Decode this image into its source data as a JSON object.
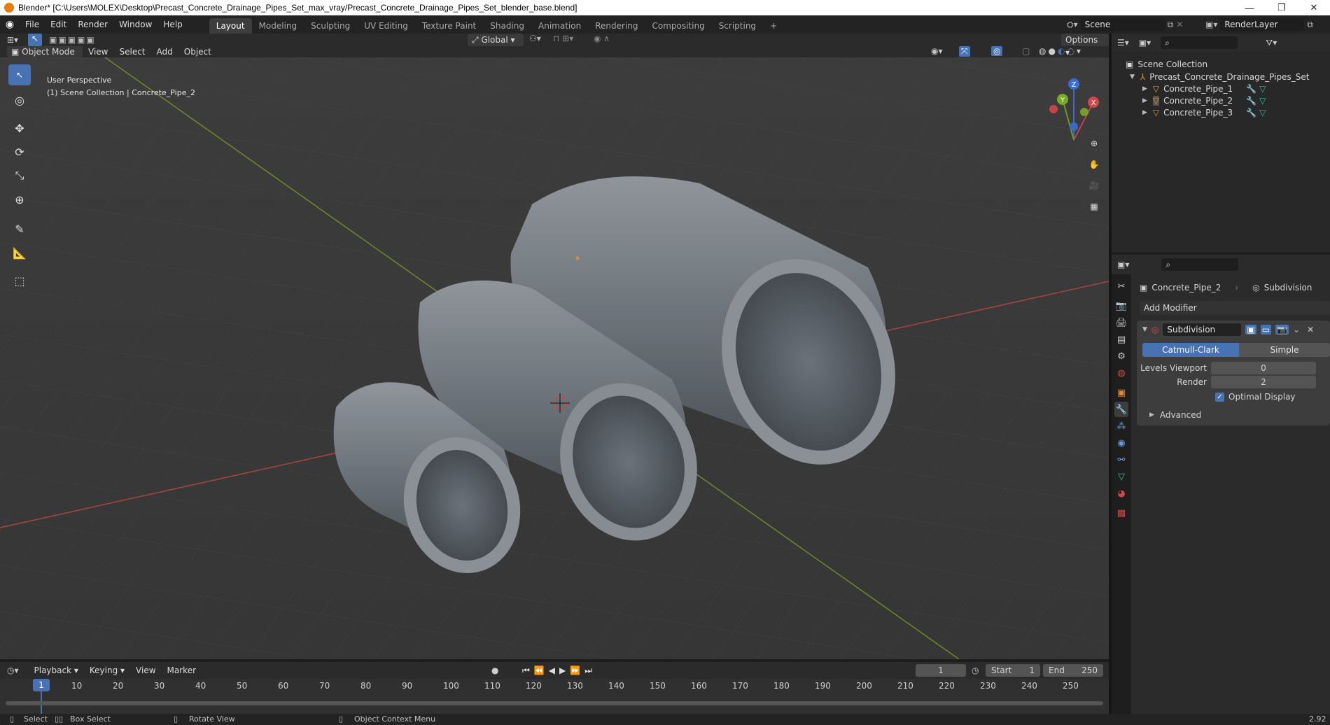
{
  "window": {
    "title": "Blender* [C:\\Users\\MOLEX\\Desktop\\Precast_Concrete_Drainage_Pipes_Set_max_vray/Precast_Concrete_Drainage_Pipes_Set_blender_base.blend]",
    "minimize": "—",
    "maximize": "❐",
    "close": "✕"
  },
  "menu": [
    "File",
    "Edit",
    "Render",
    "Window",
    "Help"
  ],
  "workspaces": [
    "Layout",
    "Modeling",
    "Sculpting",
    "UV Editing",
    "Texture Paint",
    "Shading",
    "Animation",
    "Rendering",
    "Compositing",
    "Scripting",
    "+"
  ],
  "scene": {
    "name": "Scene",
    "render_layer": "RenderLayer"
  },
  "viewport_header": {
    "orientation": "Global",
    "options": "Options",
    "mode": "Object Mode",
    "view": "View",
    "select": "Select",
    "add": "Add",
    "object": "Object"
  },
  "viewport": {
    "perspective": "User Perspective",
    "collection_info": "(1) Scene Collection | Concrete_Pipe_2"
  },
  "gizmo": {
    "z": "Z",
    "y": "Y",
    "x": "X"
  },
  "outliner": {
    "root": "Scene Collection",
    "collection": "Precast_Concrete_Drainage_Pipes_Set",
    "items": [
      "Concrete_Pipe_1",
      "Concrete_Pipe_2",
      "Concrete_Pipe_3"
    ]
  },
  "properties": {
    "object_name": "Concrete_Pipe_2",
    "modifier_label": "Subdivision",
    "add_modifier": "Add Modifier",
    "modifier": {
      "name": "Subdivision",
      "mode_a": "Catmull-Clark",
      "mode_b": "Simple",
      "levels_viewport_label": "Levels Viewport",
      "levels_viewport": "0",
      "render_label": "Render",
      "render": "2",
      "optimal_display": "Optimal Display",
      "optimal_display_checked": true,
      "advanced": "Advanced"
    }
  },
  "timeline": {
    "playback": "Playback",
    "keying": "Keying",
    "view": "View",
    "marker": "Marker",
    "current_frame": "1",
    "start_label": "Start",
    "start": "1",
    "end_label": "End",
    "end": "250",
    "ruler": [
      "10",
      "20",
      "30",
      "40",
      "50",
      "60",
      "70",
      "80",
      "90",
      "100",
      "110",
      "120",
      "130",
      "140",
      "150",
      "160",
      "170",
      "180",
      "190",
      "200",
      "210",
      "220",
      "230",
      "240",
      "250"
    ],
    "playhead": "1"
  },
  "statusbar": {
    "select": "Select",
    "box_select": "Box Select",
    "rotate_view": "Rotate View",
    "context_menu": "Object Context Menu",
    "version": "2.92"
  },
  "colors": {
    "accent": "#4772b3",
    "x_axis": "#c04040",
    "y_axis": "#7a9a2a",
    "object_orange": "#e8892b",
    "mesh_green": "#27c3a0"
  }
}
